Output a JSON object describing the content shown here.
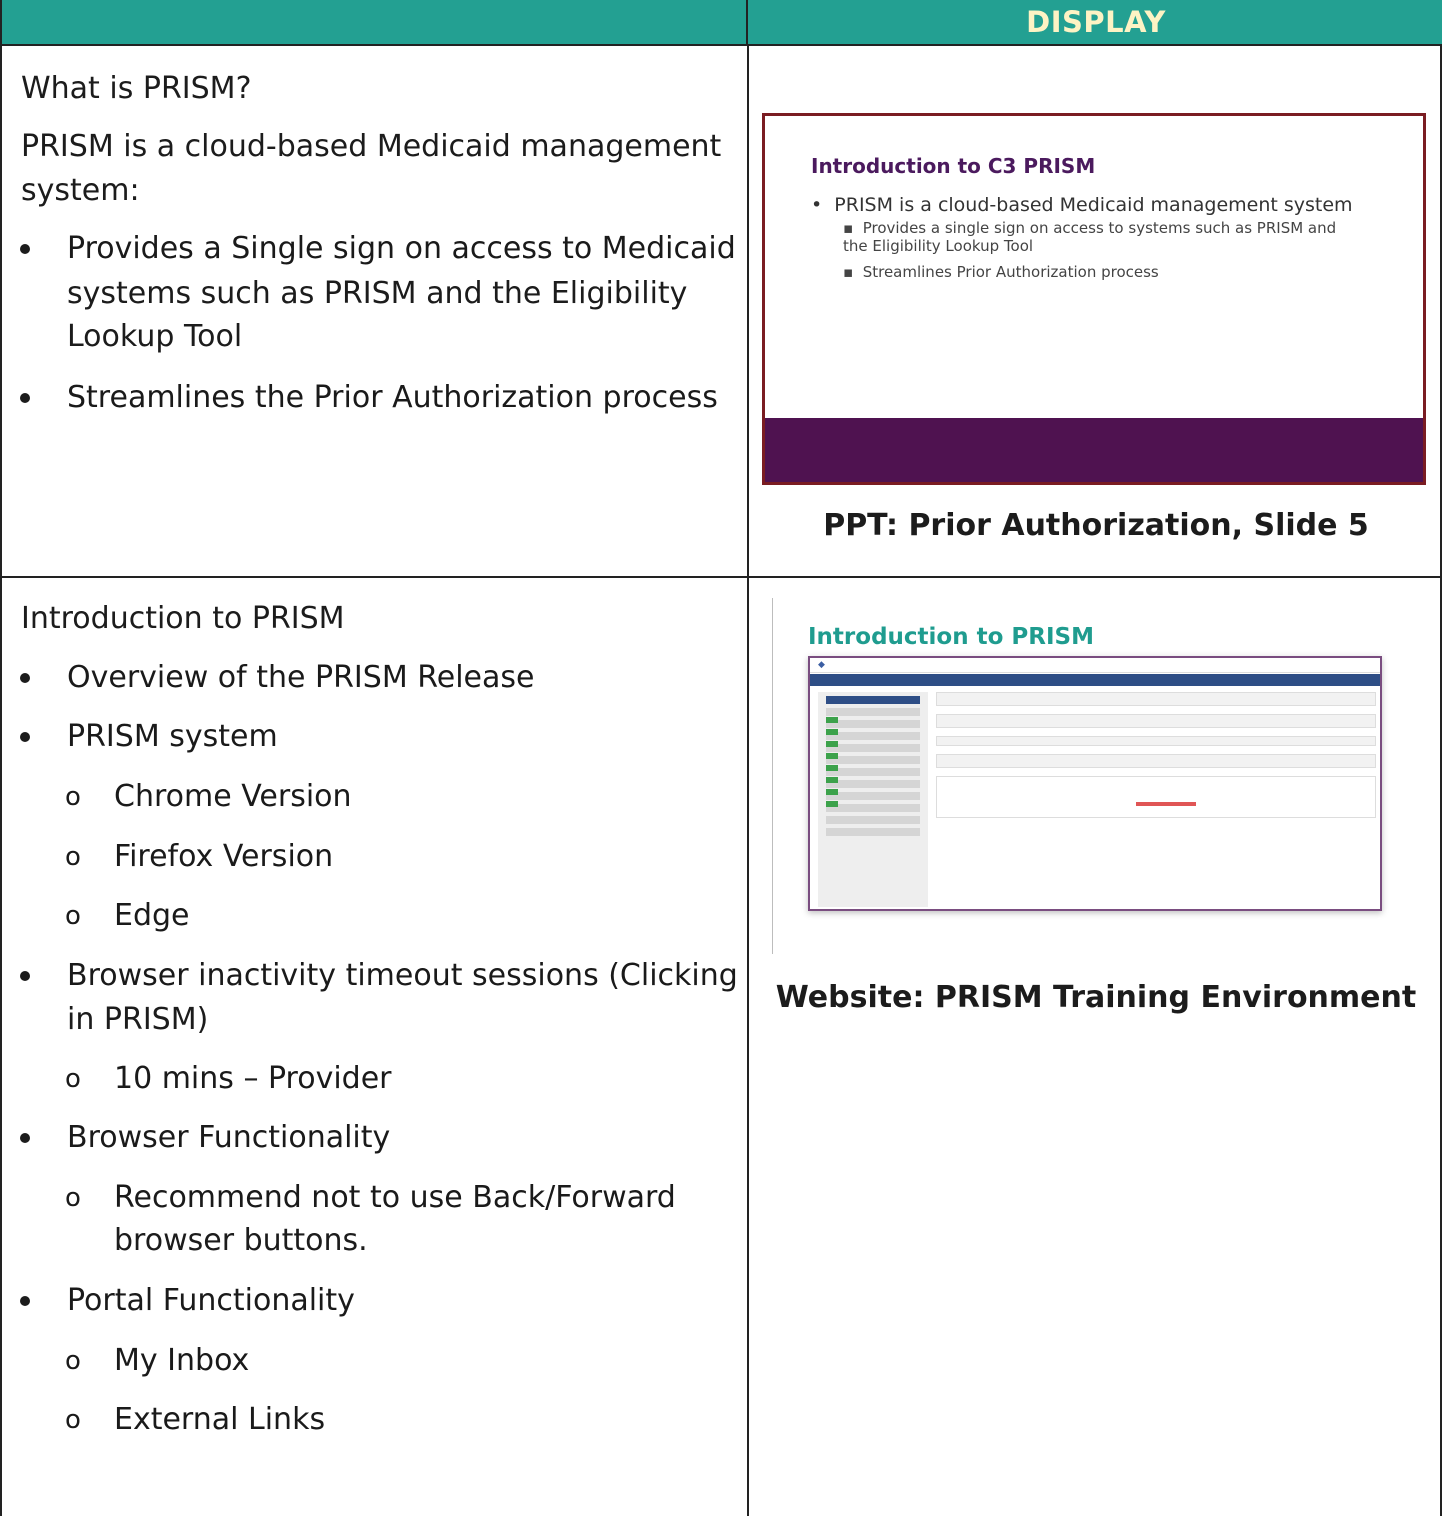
{
  "header": {
    "display_label": "DISPLAY"
  },
  "row1": {
    "question": "What is PRISM?",
    "intro": "PRISM is a cloud-based Medicaid management system:",
    "intro_line1": "PRISM is a cloud-based Medicaid management",
    "intro_line2": "system:",
    "bullets": [
      {
        "line1": "Provides a Single sign on access to Medicaid",
        "line2": "systems such as PRISM and the Eligibility",
        "line3": "Lookup Tool"
      },
      {
        "line1": "Streamlines the Prior Authorization process"
      }
    ],
    "slide": {
      "title": "Introduction to C3 PRISM",
      "bullet": "PRISM is a cloud-based Medicaid management system",
      "sub1": "Provides a single sign on access to systems such as PRISM and the Eligibility Lookup Tool",
      "sub2": "Streamlines Prior Authorization process"
    },
    "caption": "PPT: Prior Authorization, Slide 5"
  },
  "row2": {
    "heading": "Introduction to PRISM",
    "items": {
      "overview": "Overview of the PRISM Release",
      "system": "PRISM system",
      "chrome": "Chrome Version",
      "firefox": "Firefox Version",
      "edge": "Edge",
      "timeout_line1": "Browser inactivity timeout sessions (Clicking",
      "timeout_line2": "in PRISM)",
      "provider": "10 mins – Provider",
      "browser_func": "Browser Functionality",
      "recommend_line1": "Recommend not to use Back/Forward",
      "recommend_line2": "browser buttons.",
      "portal_func": "Portal Functionality",
      "inbox": "My Inbox",
      "external": "External Links"
    },
    "website_title": "Introduction to PRISM",
    "caption": "Website: PRISM Training Environment"
  }
}
